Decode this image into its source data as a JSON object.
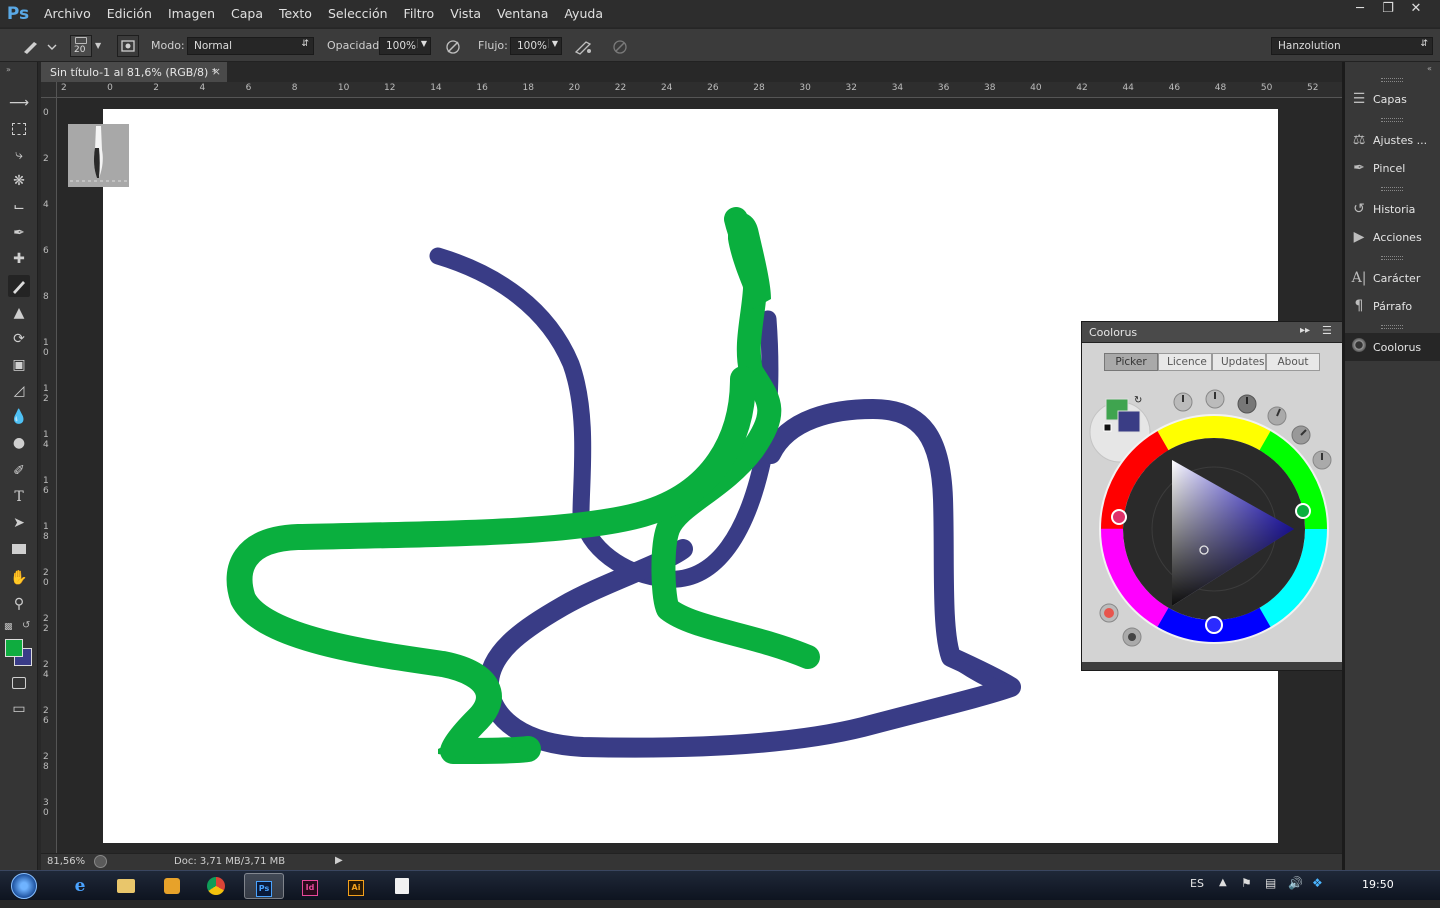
{
  "app": {
    "logo": "Ps"
  },
  "menu": [
    "Archivo",
    "Edición",
    "Imagen",
    "Capa",
    "Texto",
    "Selección",
    "Filtro",
    "Vista",
    "Ventana",
    "Ayuda"
  ],
  "window_controls": [
    "minimize-icon",
    "restore-icon",
    "close-icon"
  ],
  "options": {
    "brush_size": "20",
    "mode_label": "Modo:",
    "mode_value": "Normal",
    "opacity_label": "Opacidad:",
    "opacity_value": "100%",
    "flow_label": "Flujo:",
    "flow_value": "100%",
    "workspace": "Hanzolution"
  },
  "document": {
    "tab_title": "Sin título-1 al 81,6% (RGB/8) *",
    "close": "×"
  },
  "rulers": {
    "top": [
      "2",
      "0",
      "2",
      "4",
      "6",
      "8",
      "10",
      "12",
      "14",
      "16",
      "18",
      "20",
      "22",
      "24",
      "26",
      "28",
      "30",
      "32",
      "34",
      "36",
      "38",
      "40",
      "42",
      "44",
      "46",
      "48",
      "50",
      "52"
    ],
    "left": [
      "0",
      "2",
      "4",
      "6",
      "8",
      "1 0",
      "1 2",
      "1 4",
      "1 6",
      "1 8",
      "2 0",
      "2 2",
      "2 4",
      "2 6",
      "2 8",
      "3 0"
    ]
  },
  "status": {
    "zoom": "81,56%",
    "doc": "Doc: 3,71 MB/3,71 MB"
  },
  "dock": [
    {
      "label": "Capas",
      "icon": "layers-icon"
    },
    {
      "label": "Ajustes ...",
      "icon": "adjustments-icon"
    },
    {
      "label": "Pincel",
      "icon": "brush-icon"
    },
    {
      "label": "Historia",
      "icon": "history-icon"
    },
    {
      "label": "Acciones",
      "icon": "play-icon"
    },
    {
      "label": "Carácter",
      "icon": "character-icon"
    },
    {
      "label": "Párrafo",
      "icon": "paragraph-icon"
    },
    {
      "label": "Coolorus",
      "icon": "coolorus-icon"
    }
  ],
  "coolorus": {
    "title": "Coolorus",
    "tabs": [
      "Picker",
      "Licence",
      "Updates",
      "About"
    ],
    "active_tab": "Picker",
    "foreground_color": "#3fa44f",
    "background_color": "#3a3d85"
  },
  "colors": {
    "foreground": "#0fac3f",
    "background": "#3a3c88",
    "stroke_green": "#0aaf3e",
    "stroke_blue": "#393c86"
  },
  "taskbar": {
    "apps": [
      "start-orb-icon",
      "internet-explorer-icon",
      "explorer-folder-icon",
      "media-player-icon",
      "chrome-icon",
      "photoshop-icon",
      "indesign-icon",
      "illustrator-icon",
      "notepad-icon"
    ],
    "lang": "ES",
    "time": "19:50"
  }
}
